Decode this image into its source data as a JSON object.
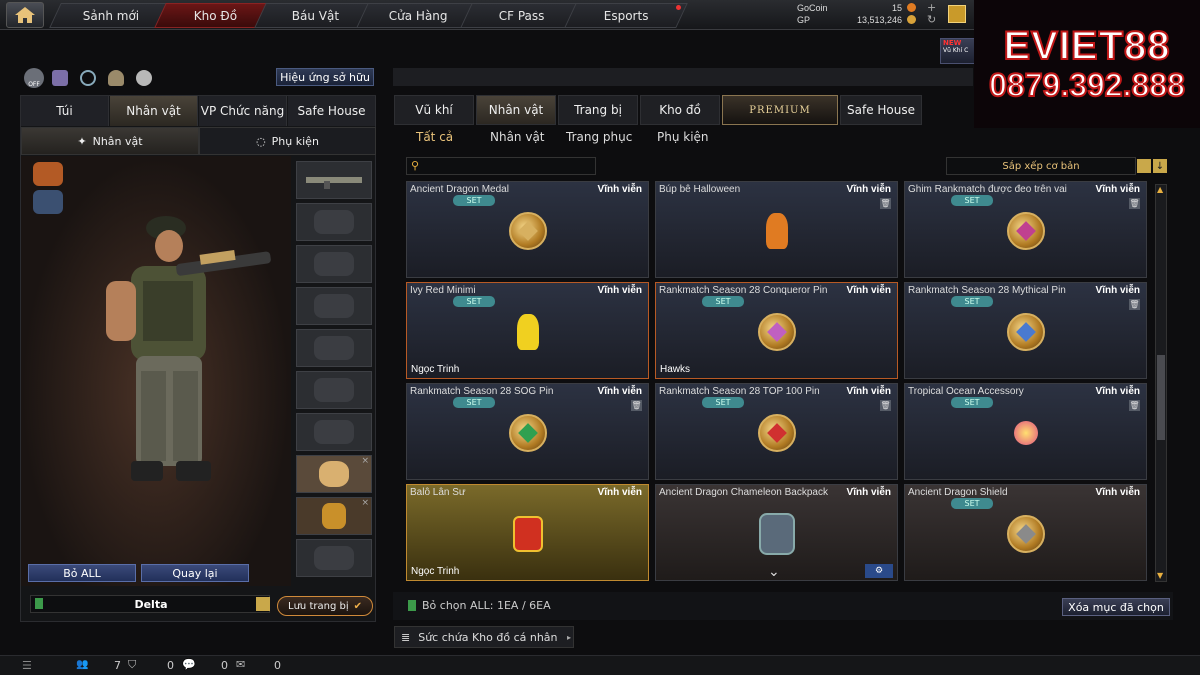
{
  "topnav": {
    "tabs": [
      "Sảnh mới",
      "Kho Đồ",
      "Báu Vật",
      "Cửa Hàng",
      "CF Pass",
      "Esports"
    ],
    "active": 1
  },
  "currency": {
    "gocoin_label": "GoCoin",
    "gocoin_value": "15",
    "gp_label": "GP",
    "gp_value": "13,513,246"
  },
  "new_badge": "NEW",
  "new_text": "Vũ Khí C",
  "promo": {
    "line1": "EVIET88",
    "line2": "0879.392.888"
  },
  "left": {
    "effect_button": "Hiệu ứng sở hữu",
    "off_label": "OFF",
    "tabs": [
      "Túi",
      "Nhân vật",
      "VP Chức năng",
      "Safe House"
    ],
    "subtabs": [
      "Nhân vật",
      "Phụ kiện"
    ],
    "reset_button": "Bỏ ALL",
    "back_button": "Quay lại",
    "preset_name": "Delta",
    "save_button": "Lưu trang bị"
  },
  "right": {
    "tabs": [
      "Vũ khí",
      "Nhân vật",
      "Trang bị",
      "Kho đồ",
      "PREMIUM",
      "Safe House"
    ],
    "filters": [
      "Tất cả",
      "Nhân vật",
      "Trang phục",
      "Phụ kiện"
    ],
    "search_placeholder": "",
    "sort_label": "Sắp xếp cơ bản",
    "selection_info": "Bỏ chọn ALL: 1EA / 6EA",
    "clear_button": "Xóa mục đã chọn",
    "storage_label": "Sức chứa Kho đồ cá nhân"
  },
  "items": [
    {
      "name": "Ancient Dragon Medal",
      "duration": "Vĩnh viễn",
      "set": "SET",
      "owner": "",
      "trash": false
    },
    {
      "name": "Búp bê Halloween",
      "duration": "Vĩnh viễn",
      "set": "",
      "owner": "",
      "trash": true
    },
    {
      "name": "Ghim Rankmatch được đeo trên vai",
      "duration": "Vĩnh viễn",
      "set": "SET",
      "owner": "",
      "trash": true
    },
    {
      "name": "Ivy Red Minimi",
      "duration": "Vĩnh viễn",
      "set": "SET",
      "owner": "Ngọc Trinh",
      "trash": false
    },
    {
      "name": "Rankmatch Season 28 Conqueror Pin",
      "duration": "Vĩnh viễn",
      "set": "SET",
      "owner": "Hawks",
      "trash": false
    },
    {
      "name": "Rankmatch Season 28 Mythical Pin",
      "duration": "Vĩnh viễn",
      "set": "SET",
      "owner": "",
      "trash": true
    },
    {
      "name": "Rankmatch Season 28 SOG Pin",
      "duration": "Vĩnh viễn",
      "set": "SET",
      "owner": "",
      "trash": true
    },
    {
      "name": "Rankmatch Season 28 TOP 100 Pin",
      "duration": "Vĩnh viễn",
      "set": "SET",
      "owner": "",
      "trash": true
    },
    {
      "name": "Tropical Ocean Accessory",
      "duration": "Vĩnh viễn",
      "set": "SET",
      "owner": "",
      "trash": true
    },
    {
      "name": "Balô Lân Sư",
      "duration": "Vĩnh viễn",
      "set": "",
      "owner": "Ngọc Trinh",
      "trash": false
    },
    {
      "name": "Ancient Dragon Chameleon Backpack",
      "duration": "Vĩnh viễn",
      "set": "",
      "owner": "",
      "trash": false
    },
    {
      "name": "Ancient Dragon Shield",
      "duration": "Vĩnh viễn",
      "set": "SET",
      "owner": "",
      "trash": false
    }
  ],
  "bottom": {
    "c1": "7",
    "c2": "0",
    "c3": "0",
    "c4": "0"
  }
}
